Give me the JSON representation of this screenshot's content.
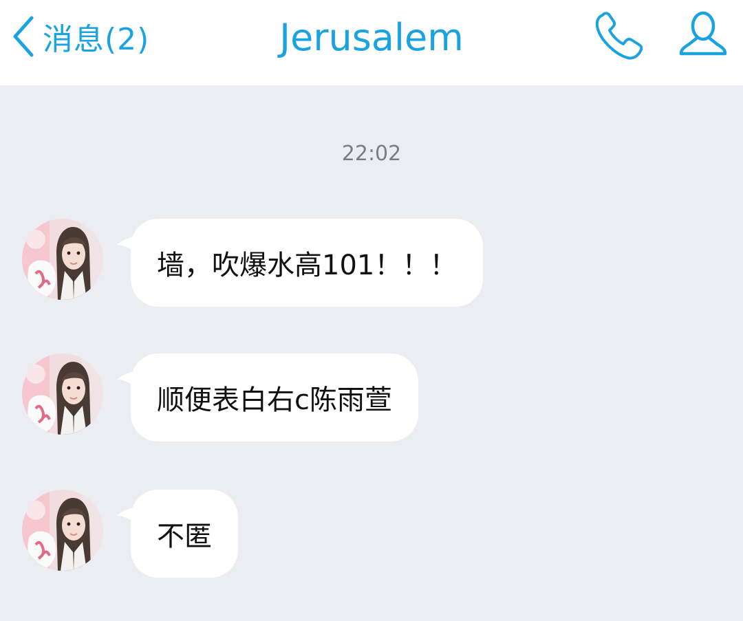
{
  "header": {
    "back_label": "消息(2)",
    "title": "Jerusalem",
    "icons": {
      "back": "chevron-left-icon",
      "call": "phone-icon",
      "profile": "person-icon"
    },
    "accent_color": "#1aa3e0"
  },
  "conversation": {
    "timestamp": "22:02",
    "messages": [
      {
        "text": "墙，吹爆水高101！！！"
      },
      {
        "text": "顺便表白右c陈雨萱"
      },
      {
        "text": "不匿"
      }
    ]
  },
  "colors": {
    "background": "#ebedf2",
    "bubble": "#ffffff",
    "header": "#ffffff",
    "timestamp": "#7a7d82",
    "text": "#111111"
  }
}
